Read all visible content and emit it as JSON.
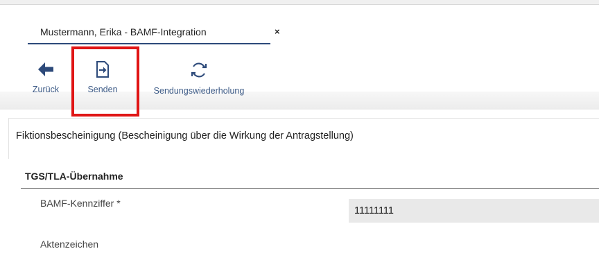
{
  "tab": {
    "title": "Mustermann, Erika - BAMF-Integration",
    "close_label": "×"
  },
  "toolbar": {
    "back": {
      "label": "Zurück",
      "icon": "arrow-left-icon"
    },
    "send": {
      "label": "Senden",
      "icon": "send-document-icon"
    },
    "resend": {
      "label": "Sendungswiederholung",
      "icon": "refresh-icon"
    }
  },
  "document": {
    "title": "Fiktionsbescheinigung (Bescheinigung über die Wirkung der Antragstellung)"
  },
  "section": {
    "header": "TGS/TLA-Übernahme",
    "fields": {
      "kennziffer": {
        "label": "BAMF-Kennziffer *",
        "value": "11111111"
      },
      "aktenzeichen": {
        "label": "Aktenzeichen"
      }
    }
  },
  "colors": {
    "accent": "#2d4a7a",
    "highlight": "#e01515",
    "link": "#3c5a86"
  }
}
